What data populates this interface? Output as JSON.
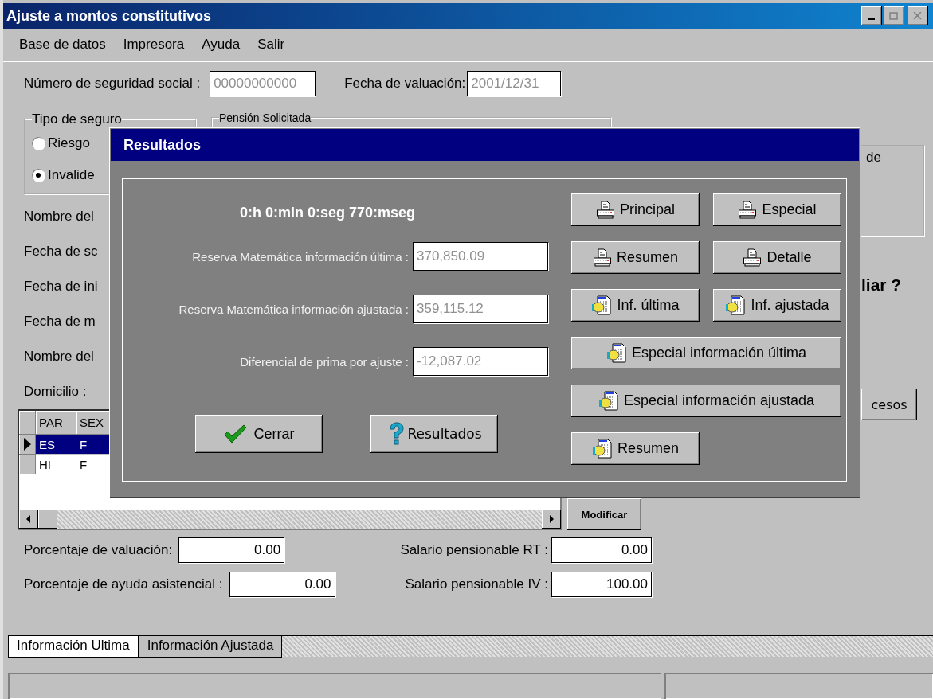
{
  "window": {
    "title": "Ajuste a montos constitutivos"
  },
  "menu": [
    "Base de datos",
    "Impresora",
    "Ayuda",
    "Salir"
  ],
  "header": {
    "nss_label": "Número de seguridad social :",
    "nss_value": "00000000000",
    "date_label": "Fecha de valuación:",
    "date_value": "2001/12/31"
  },
  "insurance_type": {
    "title": "Tipo de seguro",
    "options": [
      {
        "label": "Riesgo",
        "selected": false
      },
      {
        "label": "Invalide",
        "selected": true
      }
    ]
  },
  "pension_group": {
    "title": "Pensión Solicitada"
  },
  "labels": [
    "Nombre del",
    "Fecha de sc",
    "Fecha de ini",
    "Fecha de m",
    "Nombre del",
    "Domicilio :"
  ],
  "right_panel": {
    "group_text": "de",
    "question": "liar ?",
    "button": "cesos"
  },
  "table": {
    "columns": [
      "PAR",
      "SEX"
    ],
    "rows": [
      {
        "cells": [
          "ES",
          "F"
        ],
        "selected": true
      },
      {
        "cells": [
          "HI",
          "F"
        ],
        "selected": false
      }
    ]
  },
  "modify_button": "Modificar",
  "amounts": [
    [
      {
        "label": "Porcentaje de valuación:",
        "value": "0.00"
      },
      {
        "label": "Salario pensionable RT :",
        "value": "0.00"
      }
    ],
    [
      {
        "label": "Porcentaje de ayuda asistencial :",
        "value": "0.00"
      },
      {
        "label": "Salario pensionable IV :",
        "value": "100.00"
      }
    ]
  ],
  "tabs": [
    {
      "label": "Información Ultima",
      "selected": true
    },
    {
      "label": "Información Ajustada",
      "selected": false
    }
  ],
  "dialog": {
    "title": "Resultados",
    "elapsed": "0:h 0:min 0:seg 770:mseg",
    "fields": [
      {
        "label": "Reserva Matemática información última :",
        "value": "370,850.09",
        "disabled": true
      },
      {
        "label": "Reserva Matemática información ajustada :",
        "value": "359,115.12",
        "disabled": true
      },
      {
        "label": "Diferencial de prima por ajuste :",
        "value": "-12,087.02",
        "disabled": true
      }
    ],
    "report_buttons": [
      {
        "label": "Principal",
        "kind": "print",
        "wide": false
      },
      {
        "label": "Especial",
        "kind": "print",
        "wide": false
      },
      {
        "label": "Resumen",
        "kind": "print",
        "wide": false
      },
      {
        "label": "Detalle",
        "kind": "print",
        "wide": false
      },
      {
        "label": "Inf. última",
        "kind": "document",
        "wide": false
      },
      {
        "label": "Inf. ajustada",
        "kind": "document",
        "wide": false
      },
      {
        "label": "Especial información última",
        "kind": "document",
        "wide": true
      },
      {
        "label": "Especial información ajustada",
        "kind": "document",
        "wide": true
      },
      {
        "label": "Resumen",
        "kind": "document",
        "wide": false
      }
    ],
    "buttons": [
      {
        "label": "Cerrar",
        "kind": "check"
      },
      {
        "label": "Resultados",
        "kind": "help"
      }
    ]
  }
}
